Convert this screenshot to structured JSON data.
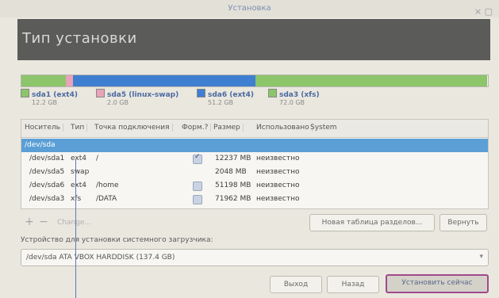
{
  "window": {
    "title": "Установка",
    "controls": "× ▢"
  },
  "header": {
    "title": "Тип установки"
  },
  "partition_bar": {
    "segments": [
      {
        "name": "sda1",
        "color": "#8cc56a",
        "fraction": 0.096
      },
      {
        "name": "sda5",
        "color": "#e8a3b8",
        "fraction": 0.016
      },
      {
        "name": "sda6",
        "color": "#3f7fd1",
        "fraction": 0.392
      },
      {
        "name": "sda3",
        "color": "#8cc56a",
        "fraction": 0.496
      }
    ]
  },
  "legend": [
    {
      "name": "sda1 (ext4)",
      "size": "12.2 GB",
      "color": "#8cc56a"
    },
    {
      "name": "sda5 (linux-swap)",
      "size": "2.0 GB",
      "color": "#e8a3b8"
    },
    {
      "name": "sda6 (ext4)",
      "size": "51.2 GB",
      "color": "#3f7fd1"
    },
    {
      "name": "sda3 (xfs)",
      "size": "72.0 GB",
      "color": "#8cc56a"
    }
  ],
  "table": {
    "headers": [
      "Носитель",
      "Тип",
      "Точка подключения",
      "Форм.?",
      "Размер",
      "Использовано",
      "System"
    ],
    "device": "/dev/sda",
    "rows": [
      {
        "device": "/dev/sda1",
        "type": "ext4",
        "mount": "/",
        "format": true,
        "size": "12237 MB",
        "used": "неизвестно"
      },
      {
        "device": "/dev/sda5",
        "type": "swap",
        "mount": "",
        "format": false,
        "size": "2048 MB",
        "used": "неизвестно"
      },
      {
        "device": "/dev/sda6",
        "type": "ext4",
        "mount": "/home",
        "format": false,
        "size": "51198 MB",
        "used": "неизвестно"
      },
      {
        "device": "/dev/sda3",
        "type": "xfs",
        "mount": "/DATA",
        "format": false,
        "size": "71962 MB",
        "used": "неизвестно"
      }
    ]
  },
  "tools": {
    "add": "+",
    "remove": "−",
    "change": "Change...",
    "new_table": "Новая таблица разделов...",
    "revert": "Вернуть"
  },
  "bootloader": {
    "label": "Устройство для установки системного загрузчика:",
    "value": "/dev/sda   ATA VBOX HARDDISK (137.4 GB)",
    "arrow": "▾"
  },
  "buttons": {
    "quit": "Выход",
    "back": "Назад",
    "install": "Установить сейчас"
  }
}
